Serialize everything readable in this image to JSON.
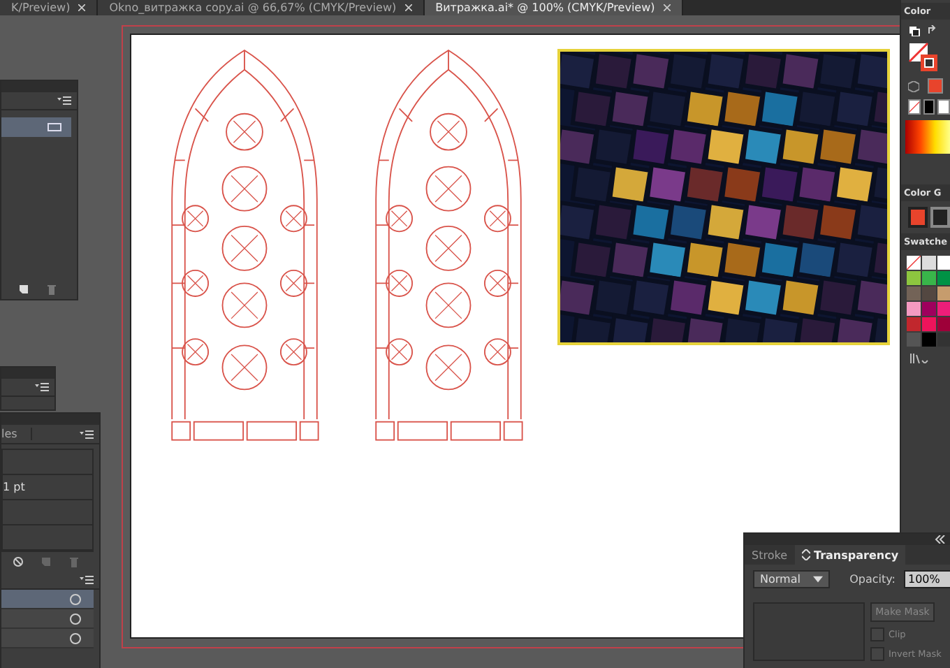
{
  "document_tabs": [
    {
      "label": "K/Preview)",
      "selected": false
    },
    {
      "label": "Okno_витражка copy.ai @ 66,67% (CMYK/Preview)",
      "selected": false
    },
    {
      "label": "Витражка.ai* @ 100% (CMYK/Preview)",
      "selected": true
    }
  ],
  "styles_panel": {
    "tab": "les",
    "rows": [
      "",
      "1 pt",
      "",
      ""
    ]
  },
  "color_panel": {
    "title": "Color"
  },
  "color_guide_panel": {
    "title": "Color G"
  },
  "swatches_panel": {
    "title": "Swatche"
  },
  "transparency_panel": {
    "tabs": [
      {
        "label": "Stroke",
        "selected": false
      },
      {
        "label": "Transparency",
        "selected": true
      }
    ],
    "blend_mode": "Normal",
    "opacity_label": "Opacity:",
    "opacity": "100%",
    "make_mask": "Make Mask",
    "options": [
      {
        "label": "Clip",
        "checked": false
      },
      {
        "label": "Invert Mask",
        "checked": false
      }
    ]
  }
}
